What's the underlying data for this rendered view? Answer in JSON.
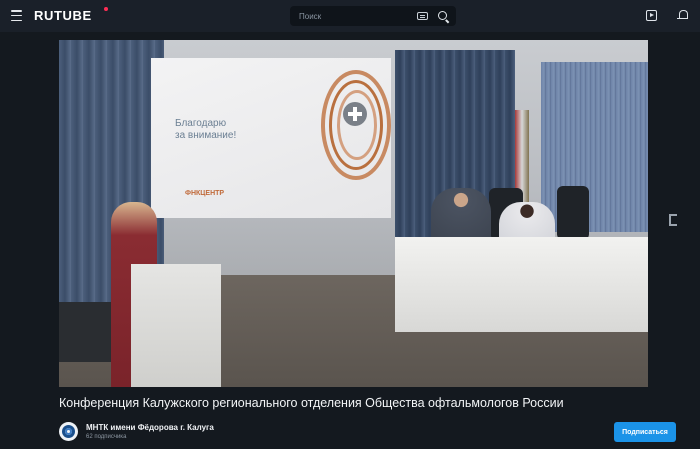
{
  "header": {
    "logo": "RUTUBE",
    "search": {
      "placeholder": "Поиск"
    },
    "icons": [
      "menu-icon",
      "keyboard-icon",
      "search-icon",
      "upload-icon",
      "bell-icon"
    ]
  },
  "player": {
    "slide_text": [
      "Благодарю",
      "за внимание!"
    ],
    "slide_logo": "ФНКЦЕНТР"
  },
  "video": {
    "title": "Конференция Калужского регионального отделения Общества офтальмологов России"
  },
  "channel": {
    "name": "МНТК имени Фёдорова г. Калуга",
    "subscribers": "62 подписчика",
    "subscribe_label": "Подписаться"
  },
  "colors": {
    "header_bg": "#1a2029",
    "page_bg": "#14191f",
    "accent": "#1b93e8",
    "logo_dot": "#ff2d55"
  }
}
